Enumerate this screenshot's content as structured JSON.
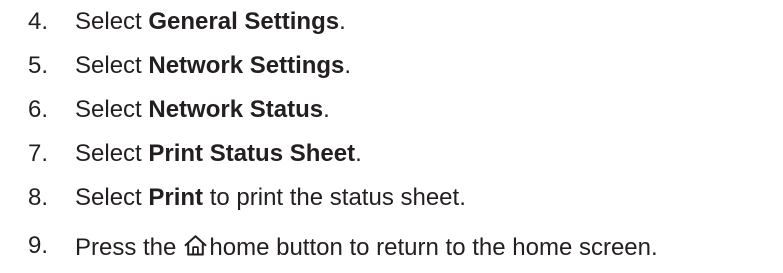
{
  "steps": [
    {
      "number": "4.",
      "prefix": "Select ",
      "emphasis": "General Settings",
      "suffix": "."
    },
    {
      "number": "5.",
      "prefix": "Select ",
      "emphasis": "Network Settings",
      "suffix": "."
    },
    {
      "number": "6.",
      "prefix": "Select ",
      "emphasis": "Network Status",
      "suffix": "."
    },
    {
      "number": "7.",
      "prefix": "Select ",
      "emphasis": "Print Status Sheet",
      "suffix": "."
    },
    {
      "number": "8.",
      "prefix": "Select ",
      "emphasis": "Print",
      "suffix": " to print the status sheet."
    },
    {
      "number": "9.",
      "prefix": "Press the",
      "icon": "home-icon",
      "suffix": "home button to return to the home screen."
    }
  ]
}
